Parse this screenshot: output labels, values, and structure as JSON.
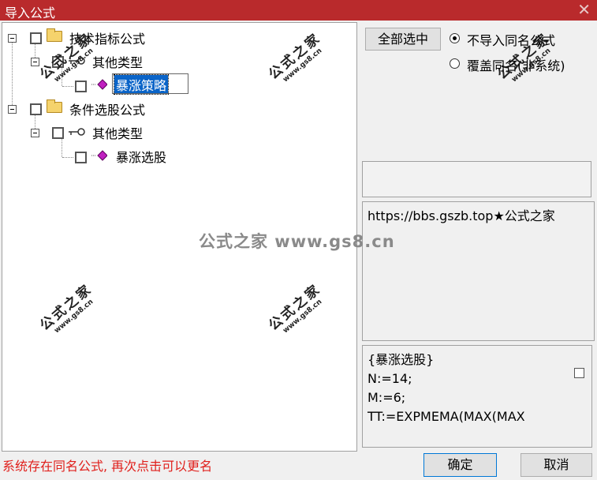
{
  "window": {
    "title": "导入公式",
    "close_glyph": "✕"
  },
  "tree": {
    "nodes": [
      {
        "label": "技术指标公式",
        "icon": "folder-icon"
      },
      {
        "label": "其他类型",
        "icon": "key-icon"
      },
      {
        "label": "暴涨策略",
        "icon": "gem-icon",
        "selected": true
      },
      {
        "label": "条件选股公式",
        "icon": "folder-icon"
      },
      {
        "label": "其他类型",
        "icon": "key-icon"
      },
      {
        "label": "暴涨选股",
        "icon": "gem-icon"
      }
    ]
  },
  "watermark": {
    "cn": "公式之家",
    "en": "www.gs8.cn",
    "center": "公式之家 www.gs8.cn"
  },
  "controls": {
    "select_all": "全部选中",
    "radio_options": [
      {
        "label": "不导入同名公式",
        "checked": true
      },
      {
        "label": "覆盖同名(非系统)",
        "checked": false
      }
    ]
  },
  "description_text": "https://bbs.gszb.top★公式之家",
  "code_text": "{暴涨选股}\nN:=14;\nM:=6;\nTT:=EXPMEMA(MAX(MAX",
  "status_message": "系统存在同名公式, 再次点击可以更名",
  "buttons": {
    "ok": "确定",
    "cancel": "取消"
  },
  "colors": {
    "titlebar": "#b92a2c",
    "status": "#e0201c",
    "selection": "#0a64c8"
  }
}
